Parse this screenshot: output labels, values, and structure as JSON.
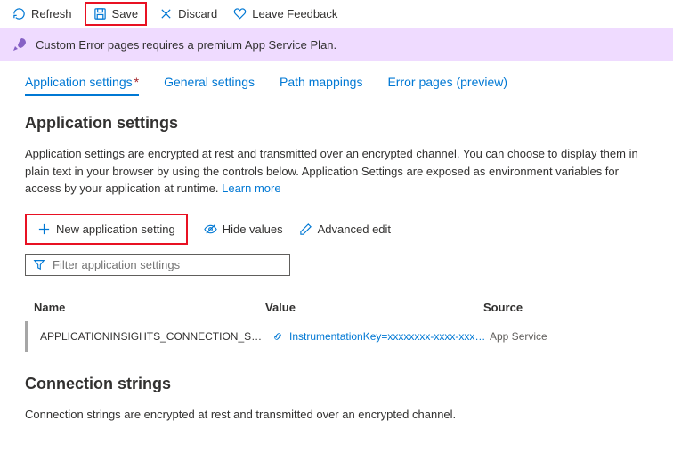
{
  "toolbar": {
    "refresh": "Refresh",
    "save": "Save",
    "discard": "Discard",
    "feedback": "Leave Feedback"
  },
  "banner": {
    "text": "Custom Error pages requires a premium App Service Plan."
  },
  "tabs": {
    "app_settings": "Application settings",
    "general": "General settings",
    "path": "Path mappings",
    "error": "Error pages (preview)"
  },
  "app_settings": {
    "title": "Application settings",
    "desc": "Application settings are encrypted at rest and transmitted over an encrypted channel. You can choose to display them in plain text in your browser by using the controls below. Application Settings are exposed as environment variables for access by your application at runtime. ",
    "learn_more": "Learn more",
    "new_setting": "New application setting",
    "hide_values": "Hide values",
    "advanced_edit": "Advanced edit",
    "filter_placeholder": "Filter application settings",
    "col_name": "Name",
    "col_value": "Value",
    "col_source": "Source",
    "row": {
      "name": "APPLICATIONINSIGHTS_CONNECTION_STRING",
      "value": "InstrumentationKey=xxxxxxxx-xxxx-xxxx-xxxx",
      "source": "App Service"
    }
  },
  "conn_strings": {
    "title": "Connection strings",
    "desc": "Connection strings are encrypted at rest and transmitted over an encrypted channel."
  }
}
